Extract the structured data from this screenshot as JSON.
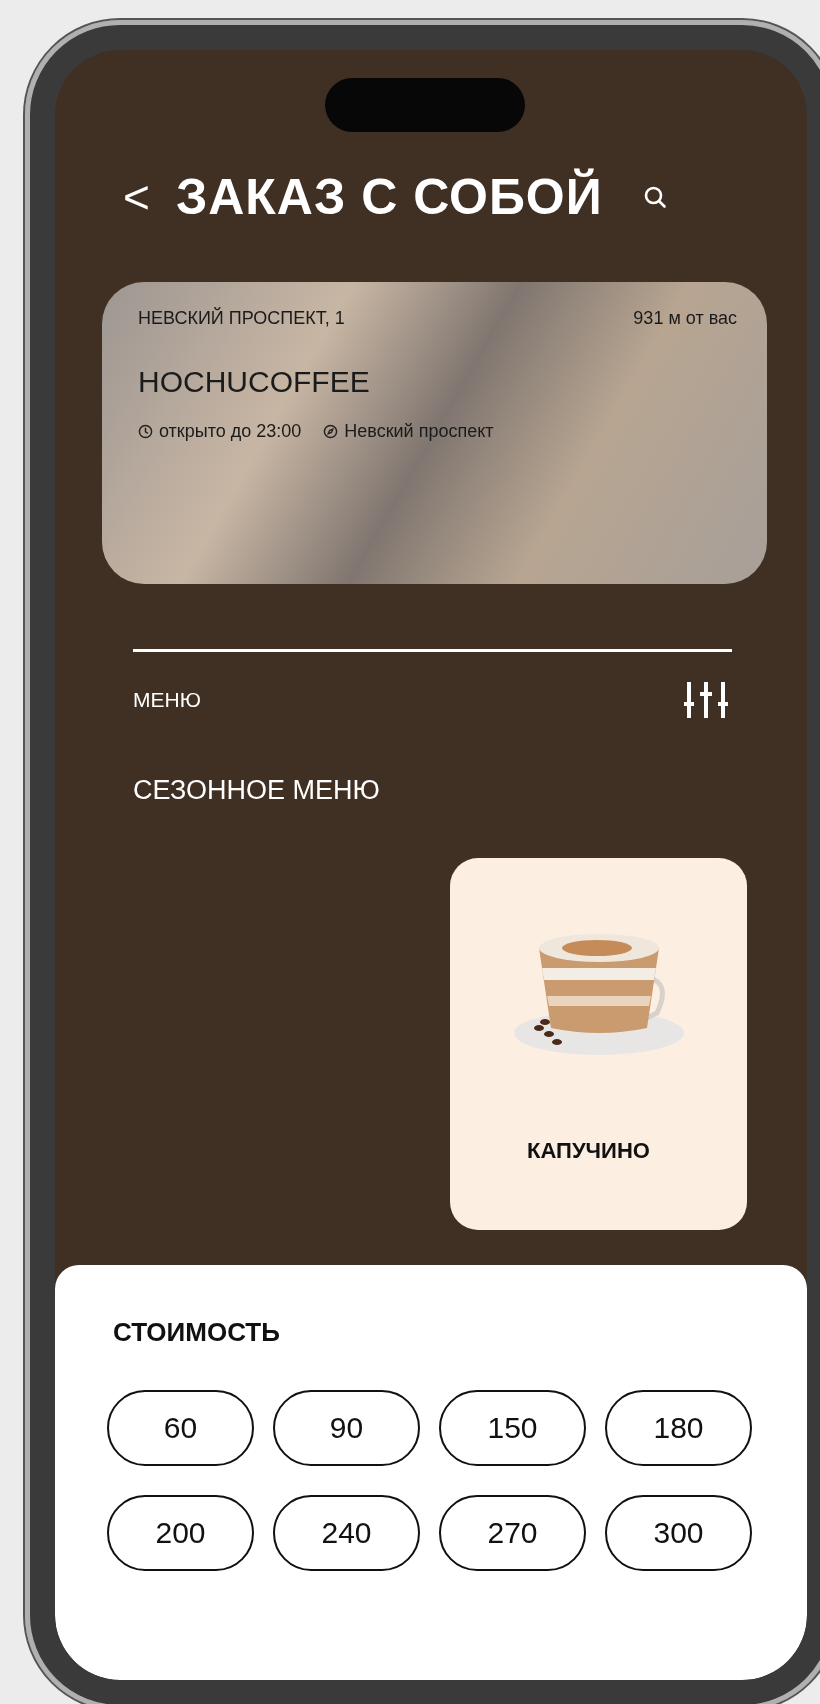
{
  "header": {
    "back": "<",
    "title": "ЗАКАЗ С СОБОЙ"
  },
  "store": {
    "address": "НЕВСКИЙ ПРОСПЕКТ, 1",
    "distance": "931 м от вас",
    "name": "HOCHUCOFFEE",
    "hours": "открыто до 23:00",
    "metro": "Невский проспект"
  },
  "menu": {
    "label": "МЕНЮ",
    "section": "СЕЗОННОЕ МЕНЮ",
    "products": [
      {
        "name": "КАПУЧИНО"
      }
    ]
  },
  "price_filter": {
    "title": "СТОИМОСТЬ",
    "options": [
      "60",
      "90",
      "150",
      "180",
      "200",
      "240",
      "270",
      "300"
    ]
  }
}
